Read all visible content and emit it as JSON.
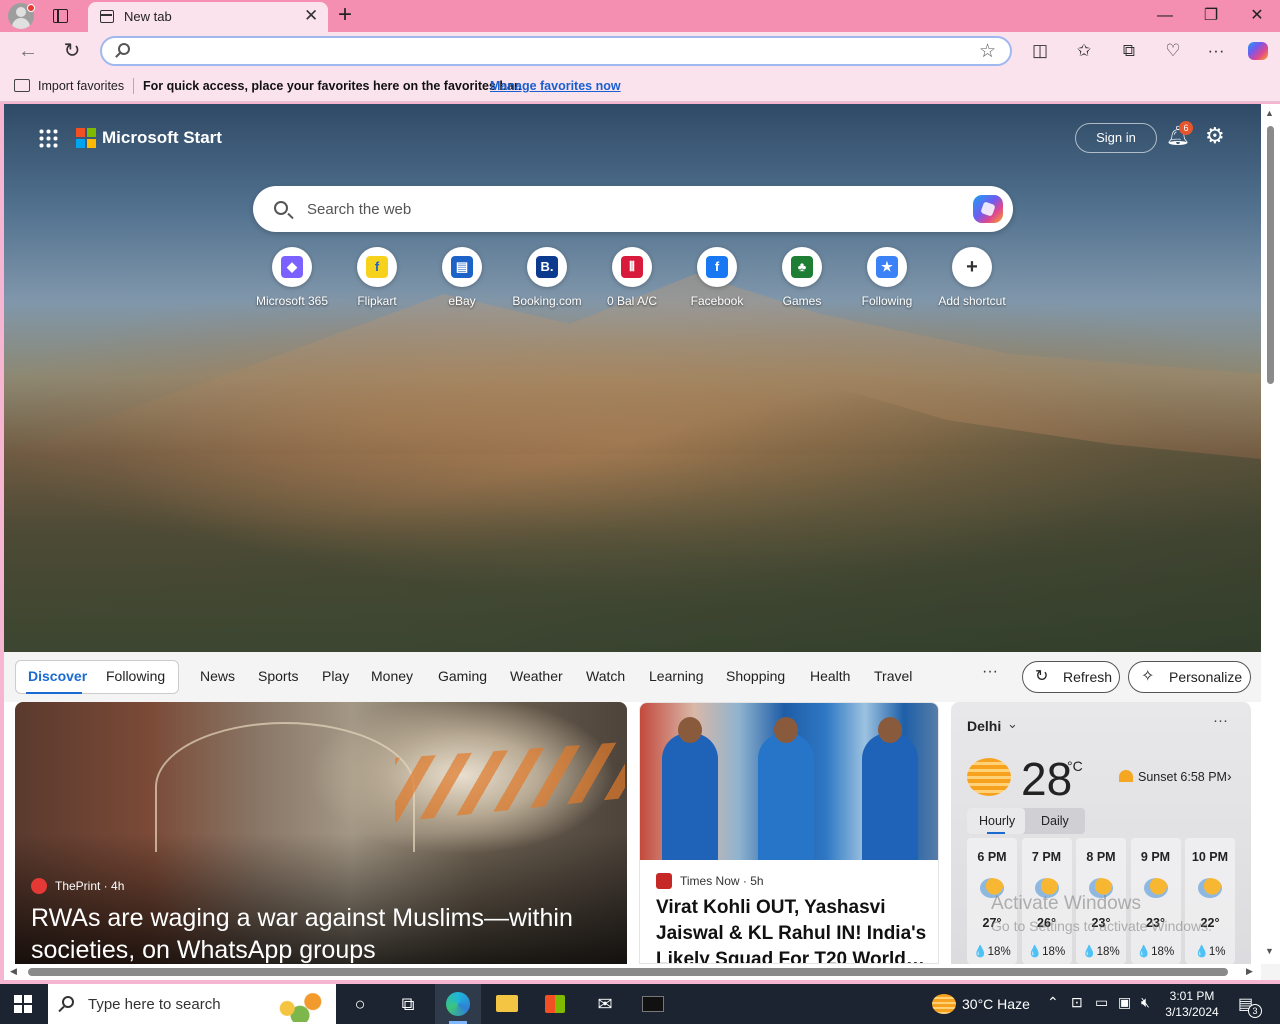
{
  "browser": {
    "tab_title": "New tab",
    "address_value": "",
    "favorites_bar": {
      "import_label": "Import favorites",
      "message": "For quick access, place your favorites here on the favorites bar.",
      "link": "Manage favorites now"
    }
  },
  "header": {
    "brand": "Microsoft Start",
    "sign_in": "Sign in",
    "notification_count": "6"
  },
  "search": {
    "placeholder": "Search the web"
  },
  "shortcuts": [
    {
      "label": "Microsoft 365",
      "icon": "microsoft-365-icon",
      "color": "#7b61ff",
      "glyph": "◆"
    },
    {
      "label": "Flipkart",
      "icon": "flipkart-icon",
      "color": "#f7d21c",
      "glyph": "f"
    },
    {
      "label": "eBay",
      "icon": "ebay-icon",
      "color": "#1d63c7",
      "glyph": "▤"
    },
    {
      "label": "Booking.com",
      "icon": "booking-icon",
      "color": "#0b3a8f",
      "glyph": "B."
    },
    {
      "label": "0 Bal A/C",
      "icon": "bank-icon",
      "color": "#d81b3c",
      "glyph": "⦀"
    },
    {
      "label": "Facebook",
      "icon": "facebook-icon",
      "color": "#1877f2",
      "glyph": "f"
    },
    {
      "label": "Games",
      "icon": "games-icon",
      "color": "#1e7e34",
      "glyph": "♣"
    },
    {
      "label": "Following",
      "icon": "following-icon",
      "color": "#3b82f6",
      "glyph": "★"
    },
    {
      "label": "Add shortcut",
      "icon": "plus-icon",
      "color": "#ffffff",
      "glyph": "+"
    }
  ],
  "feed_nav": {
    "discover": "Discover",
    "following": "Following",
    "links": [
      "News",
      "Sports",
      "Play",
      "Money",
      "Gaming",
      "Weather",
      "Watch",
      "Learning",
      "Shopping",
      "Health",
      "Travel"
    ],
    "more": "···",
    "refresh": "Refresh",
    "personalize": "Personalize"
  },
  "cards": {
    "main": {
      "source": "ThePrint · 4h",
      "headline": "RWAs are waging a war against Muslims—within societies, on WhatsApp groups"
    },
    "secondary": {
      "source": "Times Now · 5h",
      "headline": "Virat Kohli OUT, Yashasvi Jaiswal & KL Rahul IN! India's Likely Squad For T20 World…"
    }
  },
  "weather": {
    "city": "Delhi",
    "temperature": "28",
    "unit": "°C",
    "sunset": "Sunset 6:58 PM",
    "tabs": [
      "Hourly",
      "Daily"
    ],
    "hourly": [
      {
        "time": "6 PM",
        "temp": "27°",
        "precip": "💧18%"
      },
      {
        "time": "7 PM",
        "temp": "26°",
        "precip": "💧18%"
      },
      {
        "time": "8 PM",
        "temp": "23°",
        "precip": "💧18%"
      },
      {
        "time": "9 PM",
        "temp": "23°",
        "precip": "💧18%"
      },
      {
        "time": "10 PM",
        "temp": "22°",
        "precip": "💧1%"
      }
    ]
  },
  "watermark": {
    "line1": "Activate Windows",
    "line2": "Go to Settings to activate Windows."
  },
  "taskbar": {
    "search_placeholder": "Type here to search",
    "weather": "30°C  Haze",
    "time": "3:01 PM",
    "date": "3/13/2024",
    "notification_count": "3"
  }
}
